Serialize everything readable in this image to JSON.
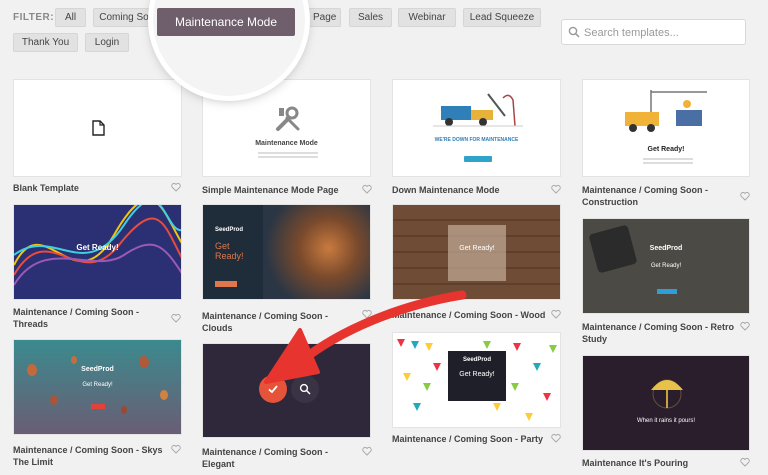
{
  "filters": {
    "label": "FILTER:",
    "chips": [
      "All",
      "Coming So",
      "4 Page",
      "Sales",
      "Webinar",
      "Lead Squeeze",
      "Thank You",
      "Login"
    ],
    "active": "Maintenance Mode"
  },
  "search": {
    "placeholder": "Search templates..."
  },
  "cards": [
    {
      "title": "Blank Template"
    },
    {
      "title": "Simple Maintenance Mode Page",
      "text": "Maintenance Mode"
    },
    {
      "title": "Down Maintenance Mode",
      "text": "WE'RE DOWN FOR MAINTENANCE"
    },
    {
      "title": "Maintenance / Coming Soon - Construction",
      "text": "Get Ready!"
    },
    {
      "title": "Maintenance / Coming Soon - Threads",
      "text": "Get Ready!"
    },
    {
      "title": "Maintenance / Coming Soon - Clouds",
      "brand": "SeedProd",
      "text": "Get Ready!"
    },
    {
      "title": "Maintenance / Coming Soon - Wood",
      "text": "Get Ready!"
    },
    {
      "title": "Maintenance / Coming Soon - Retro Study",
      "brand": "SeedProd",
      "text": "Get Ready!"
    },
    {
      "title": "Maintenance / Coming Soon - Skys The Limit",
      "brand": "SeedProd",
      "text": "Get Ready!"
    },
    {
      "title": "Maintenance / Coming Soon - Elegant"
    },
    {
      "title": "Maintenance / Coming Soon - Party",
      "brand": "SeedProd",
      "text": "Get Ready!"
    },
    {
      "title": "Maintenance It's Pouring",
      "text": "When it rains it pours!"
    }
  ],
  "colors": {
    "accent": "#6f5e6c",
    "arrow": "#e8342e",
    "select": "#e5533a"
  }
}
